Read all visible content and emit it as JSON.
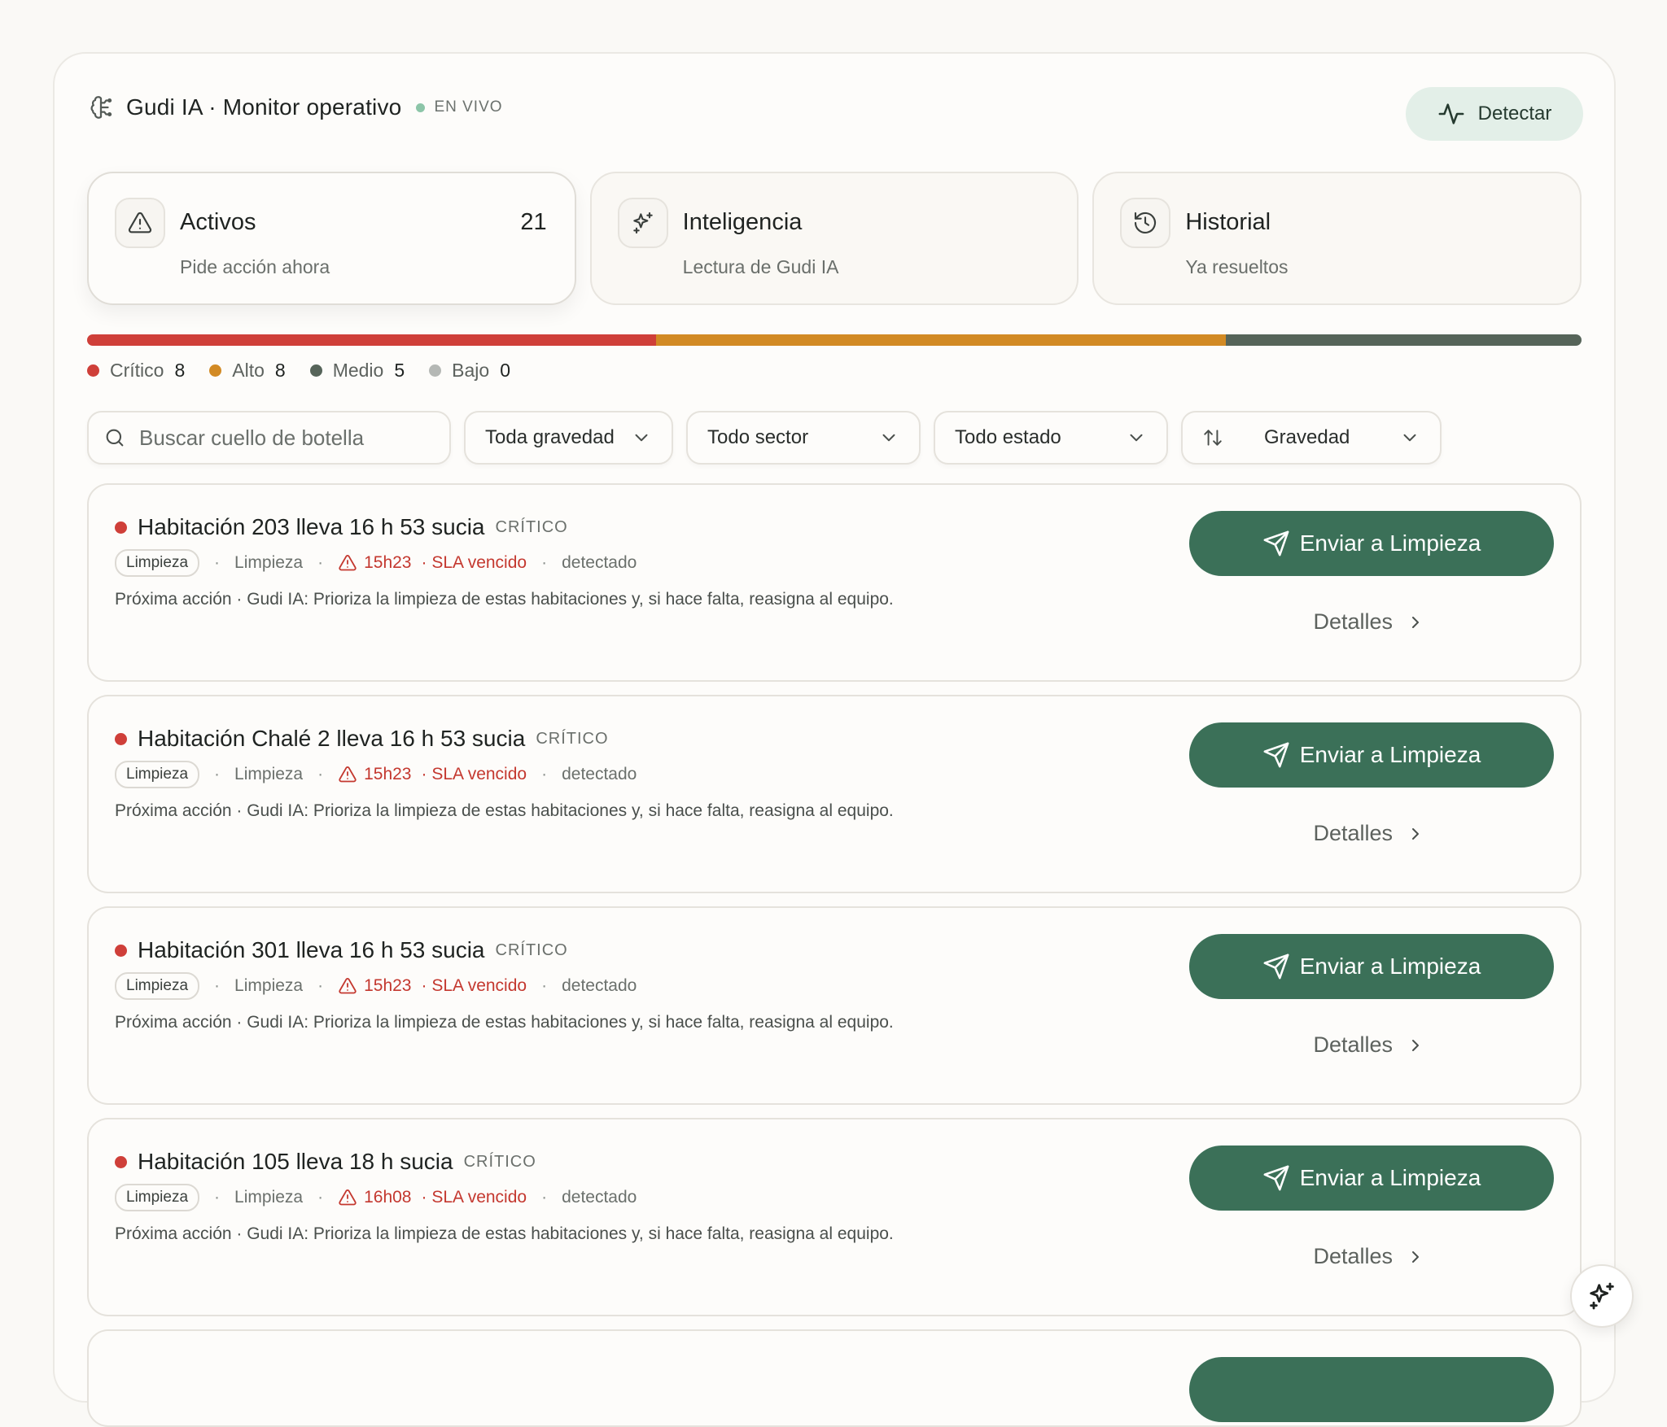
{
  "header": {
    "title": "Gudi IA · Monitor operativo",
    "live_label": "EN VIVO",
    "detect_label": "Detectar",
    "brand_icon": "brain-icon"
  },
  "tabs": [
    {
      "title": "Activos",
      "subtitle": "Pide acción ahora",
      "count": "21",
      "icon": "alert-triangle-icon",
      "active": true
    },
    {
      "title": "Inteligencia",
      "subtitle": "Lectura de Gudi IA",
      "icon": "sparkles-icon"
    },
    {
      "title": "Historial",
      "subtitle": "Ya resueltos",
      "icon": "history-icon"
    }
  ],
  "severity": {
    "segments": [
      {
        "label": "Crítico",
        "count": "8",
        "color": "#cf3f39"
      },
      {
        "label": "Alto",
        "count": "8",
        "color": "#d28a24"
      },
      {
        "label": "Medio",
        "count": "5",
        "color": "#566459"
      },
      {
        "label": "Bajo",
        "count": "0",
        "color": "#b5b8b5"
      }
    ]
  },
  "filters": {
    "search_placeholder": "Buscar cuello de botella",
    "severity": "Toda gravedad",
    "sector": "Todo sector",
    "status": "Todo estado",
    "sort": "Gravedad"
  },
  "cards": [
    {
      "title": "Habitación 203 lleva 16 h 53 sucia",
      "severity": "CRÍTICO",
      "chip": "Limpieza",
      "sector": "Limpieza",
      "time": "15h23",
      "sla": "· SLA vencido",
      "status": "detectado",
      "next": "Próxima acción · Gudi IA: Prioriza la limpieza de estas habitaciones y, si hace falta, reasigna al equipo.",
      "action": "Enviar a Limpieza",
      "details": "Detalles"
    },
    {
      "title": "Habitación Chalé 2 lleva 16 h 53 sucia",
      "severity": "CRÍTICO",
      "chip": "Limpieza",
      "sector": "Limpieza",
      "time": "15h23",
      "sla": "· SLA vencido",
      "status": "detectado",
      "next": "Próxima acción · Gudi IA: Prioriza la limpieza de estas habitaciones y, si hace falta, reasigna al equipo.",
      "action": "Enviar a Limpieza",
      "details": "Detalles"
    },
    {
      "title": "Habitación 301 lleva 16 h 53 sucia",
      "severity": "CRÍTICO",
      "chip": "Limpieza",
      "sector": "Limpieza",
      "time": "15h23",
      "sla": "· SLA vencido",
      "status": "detectado",
      "next": "Próxima acción · Gudi IA: Prioriza la limpieza de estas habitaciones y, si hace falta, reasigna al equipo.",
      "action": "Enviar a Limpieza",
      "details": "Detalles"
    },
    {
      "title": "Habitación 105 lleva 18 h sucia",
      "severity": "CRÍTICO",
      "chip": "Limpieza",
      "sector": "Limpieza",
      "time": "16h08",
      "sla": "· SLA vencido",
      "status": "detectado",
      "next": "Próxima acción · Gudi IA: Prioriza la limpieza de estas habitaciones y, si hace falta, reasigna al equipo.",
      "action": "Enviar a Limpieza",
      "details": "Detalles"
    }
  ],
  "fab_icon": "sparkles-icon"
}
